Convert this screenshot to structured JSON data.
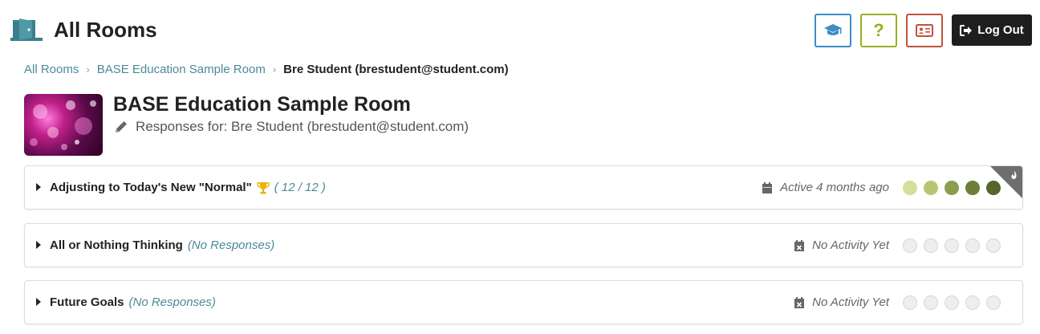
{
  "header": {
    "title": "All Rooms",
    "help_label": "?",
    "logout_label": "Log Out"
  },
  "breadcrumb": {
    "items": [
      "All Rooms",
      "BASE Education Sample Room"
    ],
    "current": "Bre Student (brestudent@student.com)"
  },
  "room": {
    "title": "BASE Education Sample Room",
    "subtitle": "Responses for: Bre Student (brestudent@student.com)"
  },
  "activities": [
    {
      "title": "Adjusting to Today's New \"Normal\"",
      "count": "( 12 / 12 )",
      "status": "Active 4 months ago",
      "completed": true,
      "dot_colors": [
        "#d3e09a",
        "#b6c774",
        "#8c9d50",
        "#6e7f38",
        "#56652a"
      ]
    },
    {
      "title": "All or Nothing Thinking",
      "count": "(No Responses)",
      "status": "No Activity Yet",
      "completed": false,
      "dot_colors": []
    },
    {
      "title": "Future Goals",
      "count": "(No Responses)",
      "status": "No Activity Yet",
      "completed": false,
      "dot_colors": []
    }
  ],
  "colors": {
    "link": "#4a8a9a",
    "edu_button": "#3b8ec8",
    "help_button": "#9bb020",
    "card_button": "#c0533a",
    "trophy": "#e8b400"
  }
}
